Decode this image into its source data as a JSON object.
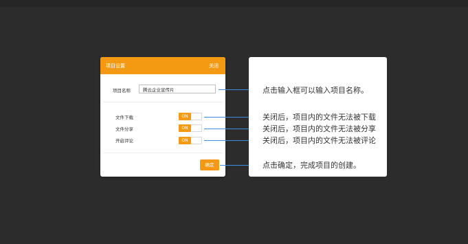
{
  "dialog": {
    "title": "项目设置",
    "close_label": "关闭",
    "name_label": "项目名称",
    "name_value": "腾云企业宣传片",
    "options": [
      {
        "label": "文件下载",
        "toggle": "ON"
      },
      {
        "label": "文件分享",
        "toggle": "ON"
      },
      {
        "label": "开启评论",
        "toggle": "ON"
      }
    ],
    "confirm_label": "确定"
  },
  "callouts": [
    "点击输入框可以输入项目名称。",
    "关闭后，项目内的文件无法被下载",
    "关闭后，项目内的文件无法被分享",
    "关闭后，项目内的文件无法被评论",
    "点击确定，完成项目的创建。"
  ],
  "colors": {
    "accent": "#f39a12",
    "connector": "#3a8ee6",
    "background": "#2c2c2c"
  }
}
